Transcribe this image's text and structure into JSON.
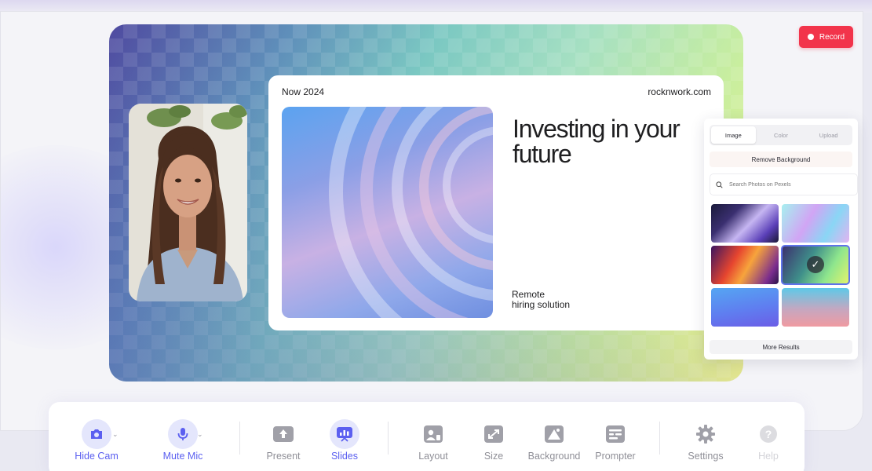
{
  "stage": {
    "slide": {
      "date": "Now 2024",
      "site": "rocknwork.com",
      "heading": "Investing in your future",
      "subtitle_line1": "Remote",
      "subtitle_line2": "hiring solution"
    }
  },
  "record": {
    "label": "Record",
    "color": "#f2344b"
  },
  "background_panel": {
    "tabs": [
      {
        "label": "Image",
        "active": true
      },
      {
        "label": "Color",
        "active": false
      },
      {
        "label": "Upload",
        "active": false
      }
    ],
    "remove_label": "Remove Background",
    "search_placeholder": "Search Photos on Pexels",
    "selected_index": 3,
    "more_label": "More Results"
  },
  "toolbar": {
    "hide_cam": "Hide Cam",
    "mute_mic": "Mute Mic",
    "present": "Present",
    "slides": "Slides",
    "layout": "Layout",
    "size": "Size",
    "background": "Background",
    "prompter": "Prompter",
    "settings": "Settings",
    "help": "Help"
  },
  "colors": {
    "accent": "#5b5ff0",
    "accent_soft": "#e4e6fc",
    "record": "#f2344b"
  }
}
